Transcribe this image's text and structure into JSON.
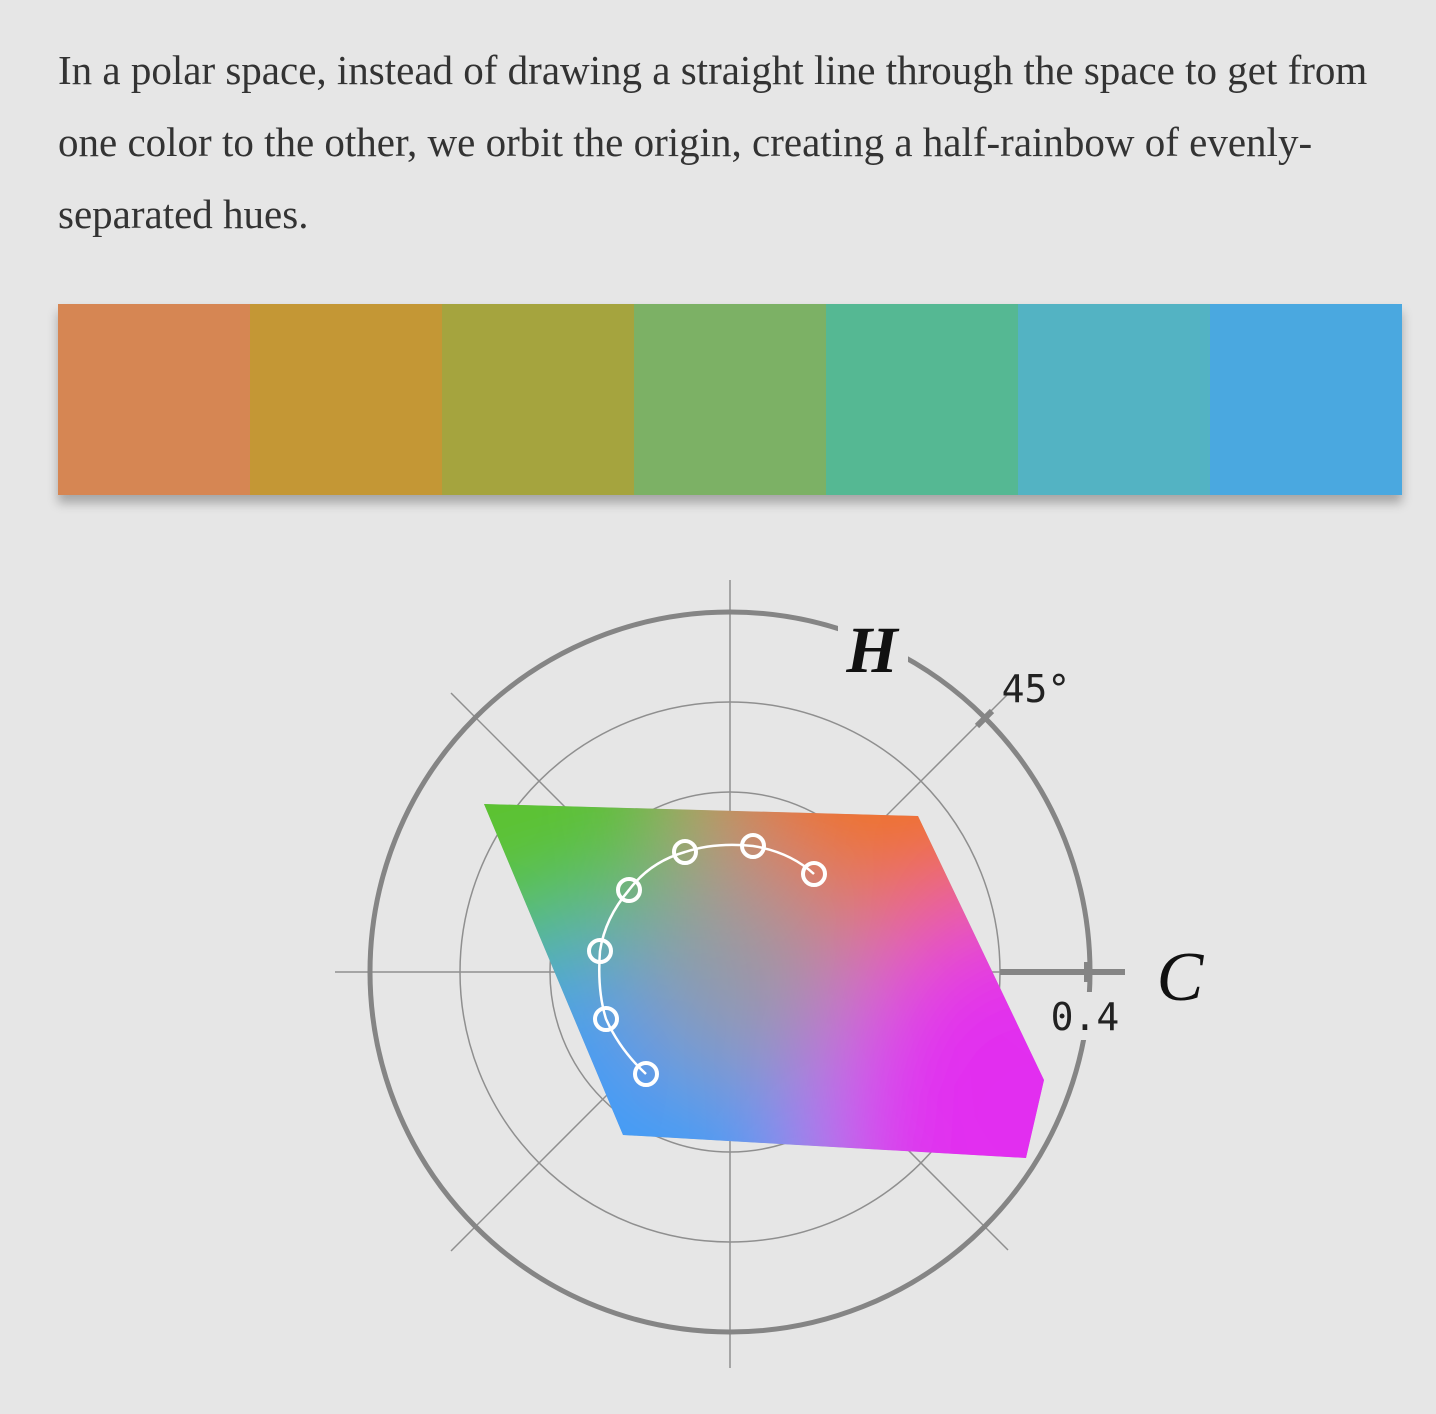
{
  "text": {
    "paragraph": "In a polar space, instead of drawing a straight line through the space to get from one color to the other, we orbit the origin, creating a half-rainbow of evenly-separated hues."
  },
  "swatches": [
    {
      "color": "#d68653"
    },
    {
      "color": "#c49735"
    },
    {
      "color": "#a5a43e"
    },
    {
      "color": "#7cb165"
    },
    {
      "color": "#55b893"
    },
    {
      "color": "#53b3c3"
    },
    {
      "color": "#4aa8e0"
    }
  ],
  "diagram": {
    "hue_axis_label": "H",
    "hue_tick_label": "45°",
    "chroma_axis_label": "C",
    "chroma_tick_label": "0.4",
    "gradient_corner_colors": {
      "top_left": "#5cc233",
      "top_right": "#ef7227",
      "bottom_right": "#e22ef0",
      "bottom_left": "#3f9cf8",
      "center": "#959aa6"
    },
    "path_point_count": 7
  }
}
